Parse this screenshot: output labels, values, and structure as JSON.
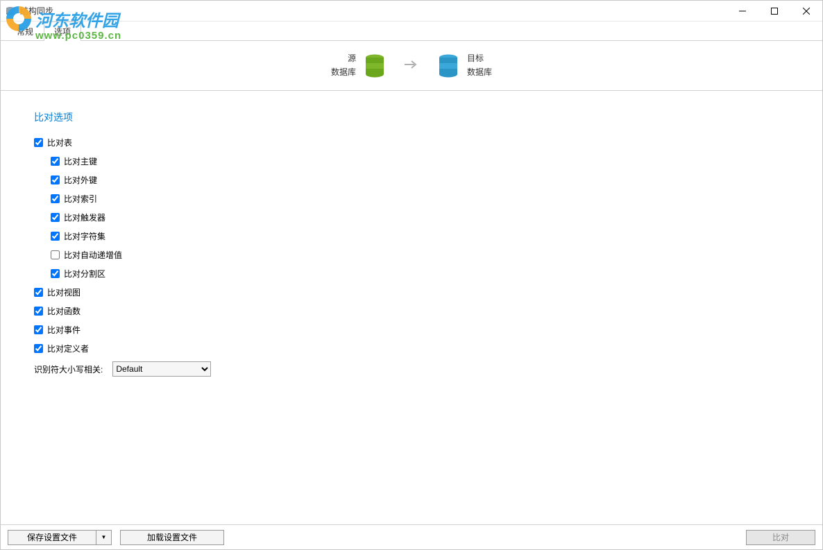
{
  "window": {
    "title": "结构同步"
  },
  "tabs": {
    "general": "常规",
    "options": "选项"
  },
  "header": {
    "source_label": "源",
    "source_db": "数据库",
    "target_label": "目标",
    "target_db": "数据库"
  },
  "section": {
    "title": "比对选项"
  },
  "options": {
    "compare_tables": "比对表",
    "compare_primary_keys": "比对主键",
    "compare_foreign_keys": "比对外键",
    "compare_indexes": "比对索引",
    "compare_triggers": "比对触发器",
    "compare_charset": "比对字符集",
    "compare_autoincrement": "比对自动递增值",
    "compare_partitions": "比对分割区",
    "compare_views": "比对视图",
    "compare_functions": "比对函数",
    "compare_events": "比对事件",
    "compare_definers": "比对定义者",
    "identifier_case_label": "识别符大小写相关:",
    "identifier_case_value": "Default"
  },
  "footer": {
    "save_profile": "保存设置文件",
    "dropdown_caret": "▼",
    "load_profile": "加载设置文件",
    "compare": "比对"
  },
  "watermark": {
    "text": "河东软件园",
    "url": "www.pc0359.cn"
  }
}
